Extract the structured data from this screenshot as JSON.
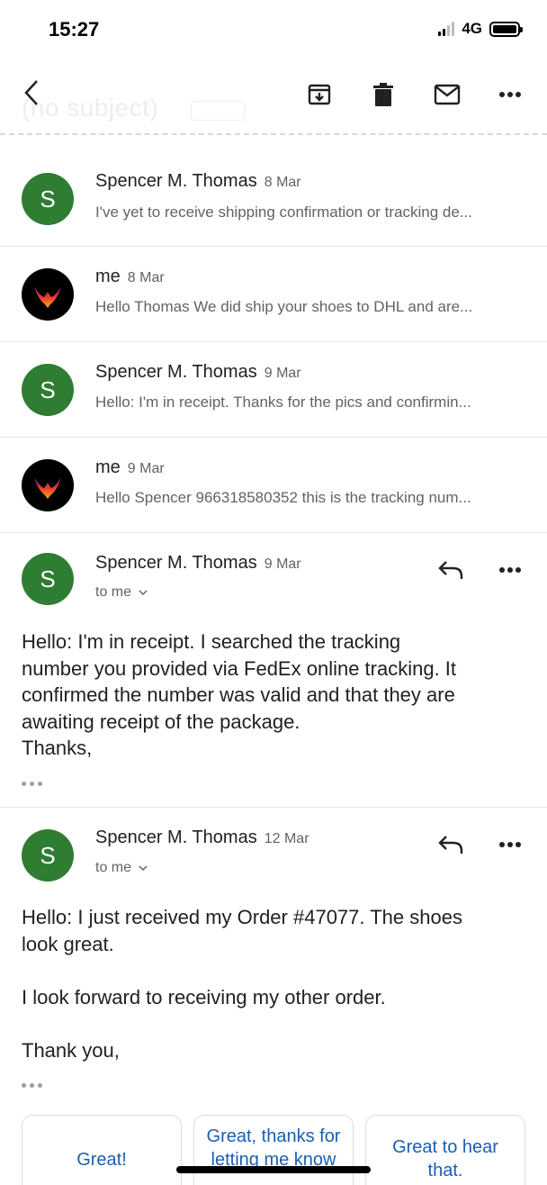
{
  "status_bar": {
    "time": "15:27",
    "network": "4G"
  },
  "toolbar": {
    "subject": "(no subject)"
  },
  "collapsed_messages": [
    {
      "sender": "Spencer M. Thomas",
      "date": "8 Mar",
      "avatar_letter": "S",
      "snippet": "I've yet to receive shipping confirmation or tracking de..."
    },
    {
      "sender": "me",
      "date": "8 Mar",
      "snippet": "Hello Thomas We did ship your shoes to DHL and are..."
    },
    {
      "sender": "Spencer M. Thomas",
      "date": "9 Mar",
      "avatar_letter": "S",
      "snippet": "Hello: I'm in receipt. Thanks for the pics and confirmin..."
    },
    {
      "sender": "me",
      "date": "9 Mar",
      "snippet": "Hello Spencer 966318580352 this is the tracking num..."
    }
  ],
  "expanded_messages": [
    {
      "sender": "Spencer M. Thomas",
      "date": "9 Mar",
      "avatar_letter": "S",
      "recipient": "to me",
      "body": "Hello: I'm in receipt. I searched the tracking\nnumber you provided via FedEx online tracking. It\nconfirmed the number was valid and that they are\nawaiting receipt of the package.\nThanks,"
    },
    {
      "sender": "Spencer M. Thomas",
      "date": "12 Mar",
      "avatar_letter": "S",
      "recipient": "to me",
      "body_lines": [
        "Hello: I just received my Order #47077. The shoes\nlook great.",
        "I look forward to receiving my other order.",
        "Thank you,"
      ]
    }
  ],
  "smart_replies": [
    "Great!",
    "Great, thanks for letting me know",
    "Great to hear that."
  ],
  "colors": {
    "avatar_green": "#2e7d32",
    "link_blue": "#1a5fb4"
  }
}
